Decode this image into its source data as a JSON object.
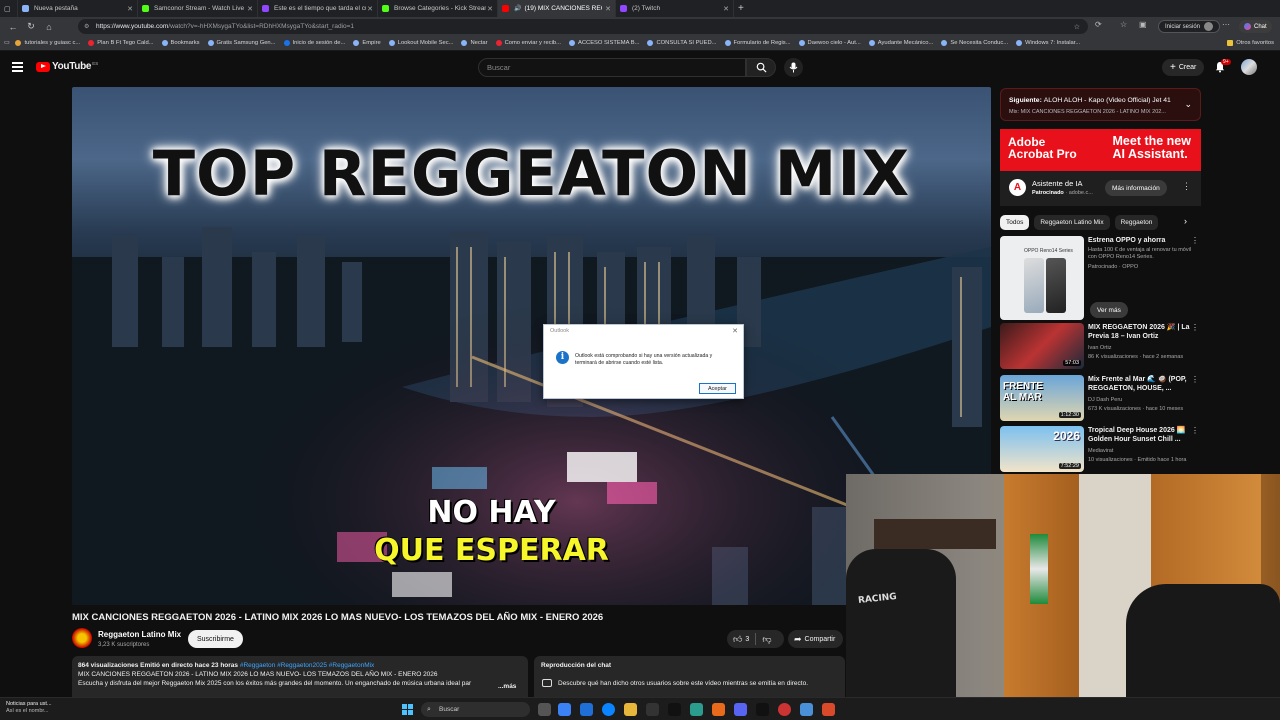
{
  "browser": {
    "tabs": [
      {
        "title": "Nueva pestaña",
        "color": "#8ab4f8",
        "active": false
      },
      {
        "title": "Samconor Stream - Watch Live on",
        "color": "#53fc18",
        "active": false
      },
      {
        "title": "Este es el tiempo que tarda el cua",
        "color": "#9146ff",
        "active": false
      },
      {
        "title": "Browse Categories - Kick Streami",
        "color": "#53fc18",
        "active": false
      },
      {
        "title": "(19) MIX CANCIONES REGG",
        "color": "#ff0000",
        "active": true
      },
      {
        "title": "(2) Twitch",
        "color": "#9146ff",
        "active": false
      }
    ],
    "new_tab_label": "+",
    "url_host": "https://www.youtube.com",
    "url_path": "/watch?v=-hHXMsygaTYo&list=RDhHXMsygaTYo&start_radio=1",
    "signin_label": "Iniciar sesión",
    "chat_label": "Chat",
    "bookmarks": [
      "tutoriales y guiasc c...",
      "Plan B Ft Tego Cald...",
      "Bookmarks",
      "Gratis Samsung Gen...",
      "Inicio de sesión de...",
      "Empire",
      "Lookout Mobile Sec...",
      "Nectar",
      "Como enviar y recib...",
      "ACCESO SISTEMA B...",
      "CONSULTA SI PUED...",
      "Formulario de Regis...",
      "Daewoo cielo - Aut...",
      "Ayudante Mecánico...",
      "Se Necesita Conduc...",
      "Windows 7: Instalar...",
      "Otros favoritos"
    ]
  },
  "youtube": {
    "logo_text": "YouTube",
    "logo_country": "ES",
    "search_placeholder": "Buscar",
    "create_label": "Crear",
    "notif_count": "9+"
  },
  "video": {
    "overlay_title": "TOP REGGEATON MIX",
    "overlay_line1": "NO HAY",
    "overlay_line2": "QUE ESPERAR",
    "title": "MIX CANCIONES REGGAETON 2026 - LATINO MIX 2026 LO MAS NUEVO- LOS TEMAZOS DEL AÑO MIX - ENERO 2026",
    "channel": "Reggaeton Latino Mix",
    "subscribers": "3,23 K suscriptores",
    "subscribe_label": "Suscribirme",
    "likes": "3",
    "share_label": "Compartir",
    "desc_meta": "864 visualizaciones  Emitió en directo hace 23 horas",
    "desc_tags": "#Reggaeton #Reggaeton2025 #ReggaetonMix",
    "desc_line2": "MIX CANCIONES REGGAETON 2026 - LATINO MIX 2026 LO MAS NUEVO- LOS TEMAZOS DEL AÑO MIX - ENERO 2026",
    "desc_line3": "Escucha y disfruta del mejor Reggaeton Mix 2025 con los éxitos más grandes del momento. Un enganchado de música urbana ideal par",
    "desc_more": "...más",
    "chat_header": "Reproducción del chat",
    "chat_text": "Descubre qué han dicho otros usuarios sobre este vídeo mientras se emitía en directo."
  },
  "dialog": {
    "title": "Outlook",
    "message": "Outlook está comprobando si hay una versión actualizada y terminará de abrirse cuando esté lista.",
    "ok_label": "Aceptar"
  },
  "sidebar": {
    "next_label": "Siguiente:",
    "next_title": "ALOH ALOH - Kapo (Video Official) Jet 41",
    "next_sub": "Mix: MIX CANCIONES REGGAETON 2026 - LATINO MIX 202...",
    "ad_left": "Adobe\nAcrobat Pro",
    "ad_right": "Meet the new\nAI Assistant.",
    "ad_name": "Asistente de IA",
    "ad_sponsor": "Patrocinado",
    "ad_domain": "adobe.c...",
    "ad_button": "Más información",
    "chips": [
      "Todos",
      "Reggaeton Latino Mix",
      "Reggaeton"
    ],
    "items": [
      {
        "title": "Estrena OPPO y ahorra",
        "channel": "Hasta 100 € de ventaja al renovar tu móvil con OPPO Reno14 Series.",
        "meta": "Patrocinado · OPPO",
        "duration": ""
      },
      {
        "title": "MIX REGGAETON 2026 🎉 | La Previa 18 – Ivan Ortiz",
        "channel": "Ivan Ortiz",
        "meta": "86 K visualizaciones · hace 2 semanas",
        "duration": "57:03"
      },
      {
        "title": "Mix Frente al Mar 🌊 🥥 (POP, REGGAETON, HOUSE, ...",
        "channel": "DJ Dash Peru",
        "meta": "673 K visualizaciones · hace 10 meses",
        "duration": "1:12:30"
      },
      {
        "title": "Tropical Deep House 2026 🌅 Golden Hour Sunset Chill ...",
        "channel": "Mediavirat",
        "meta": "10 visualizaciones · Emitido hace 1 hora",
        "duration": "7:52:29"
      }
    ],
    "ver_mas": "Ver más",
    "oppo_label": "OPPO Reno14 Series",
    "thumb_label_frente": "FRENTE AL MAR",
    "thumb_label_2026": "2026"
  },
  "webcam": {
    "chair_text": "RACING"
  },
  "taskbar": {
    "news_title": "Noticias para ust...",
    "news_sub": "Así es el nombr...",
    "search_label": "Buscar"
  }
}
